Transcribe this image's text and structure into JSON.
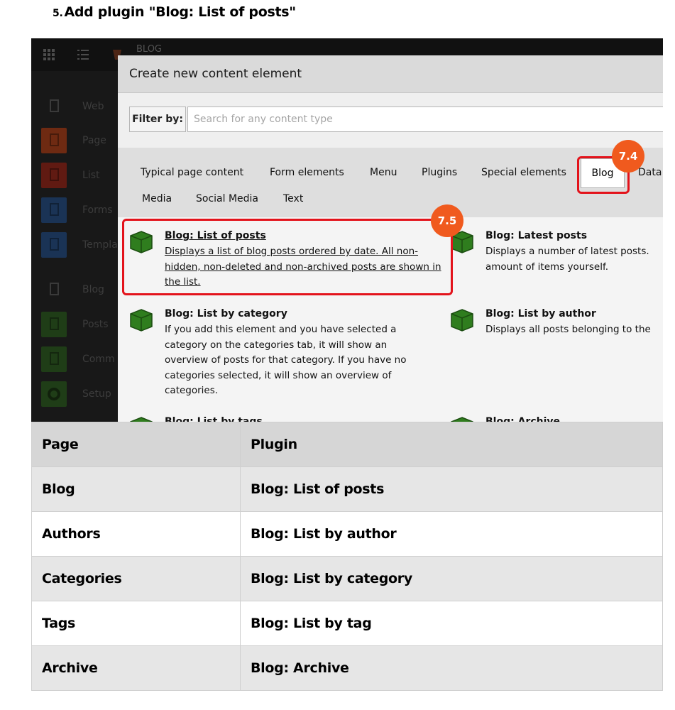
{
  "step": {
    "number": "5.",
    "title": "Add plugin \"Blog: List of posts\""
  },
  "screenshot": {
    "topbar_title": "BLOG",
    "sidebar": [
      {
        "label": "Web",
        "icon": "page-outline-icon",
        "color": ""
      },
      {
        "label": "Page",
        "icon": "page-icon",
        "color": "#c9401c"
      },
      {
        "label": "List",
        "icon": "list-icon",
        "color": "#b3301e"
      },
      {
        "label": "Forms",
        "icon": "forms-icon",
        "color": "#2c5d9e"
      },
      {
        "label": "Templa",
        "icon": "template-icon",
        "color": "#2c5d9e"
      },
      {
        "label": "Blog",
        "icon": "blog-icon",
        "color": ""
      },
      {
        "label": "Posts",
        "icon": "posts-icon",
        "color": "#3f7f2f"
      },
      {
        "label": "Comm",
        "icon": "comments-icon",
        "color": "#3f7f2f"
      },
      {
        "label": "Setup",
        "icon": "gear-icon",
        "color": "#3f7f2f"
      }
    ],
    "modal": {
      "title": "Create new content element",
      "filter_label": "Filter by:",
      "filter_placeholder": "Search for any content type",
      "tabs": [
        "Typical page content",
        "Form elements",
        "Menu",
        "Plugins",
        "Special elements",
        "Blog",
        "Data",
        "Media",
        "Social Media",
        "Text"
      ],
      "active_tab": "Blog",
      "entries": [
        {
          "title": "Blog: List of posts",
          "desc": "Displays a list of blog posts ordered by date. All non-hidden, non-deleted and non-archived posts are shown in the list."
        },
        {
          "title": "Blog: Latest posts",
          "desc": "Displays a number of latest posts. amount of items yourself."
        },
        {
          "title": "Blog: List by category",
          "desc": "If you add this element and you have selected a category on the categories tab, it will show an overview of posts for that category. If you have no categories selected, it will show an overview of categories."
        },
        {
          "title": "Blog: List by author",
          "desc": "Displays all posts belonging to the"
        },
        {
          "title": "Blog: List by tags",
          "desc": ""
        },
        {
          "title": "Blog: Archive",
          "desc": ""
        }
      ]
    },
    "badges": [
      "7.4",
      "7.5"
    ],
    "colors": {
      "badge": "#f05a1e",
      "highlight": "#e3131b",
      "cube": "#2f7d1e"
    }
  },
  "table": {
    "headers": [
      "Page",
      "Plugin"
    ],
    "rows": [
      [
        "Blog",
        "Blog: List of posts"
      ],
      [
        "Authors",
        "Blog: List by author"
      ],
      [
        "Categories",
        "Blog: List by category"
      ],
      [
        "Tags",
        "Blog: List by tag"
      ],
      [
        "Archive",
        "Blog: Archive"
      ]
    ]
  }
}
